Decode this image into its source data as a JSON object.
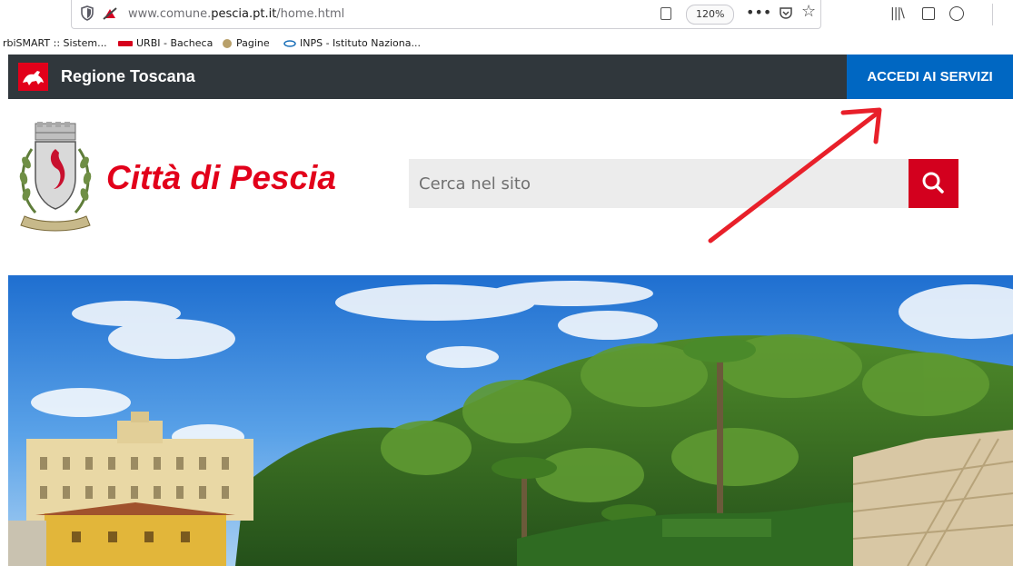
{
  "browser": {
    "url_prefix": "www.comune.",
    "url_domain": "pescia.pt.it",
    "url_path": "/home.html",
    "zoom": "120%",
    "bookmarks": [
      {
        "label": "rbiSMART :: Sistem..."
      },
      {
        "label": "URBI - Bacheca"
      },
      {
        "label": "Pagine"
      },
      {
        "label": "INPS - Istituto Naziona..."
      }
    ]
  },
  "region_bar": {
    "name": "Regione Toscana",
    "login_label": "ACCEDI AI SERVIZI"
  },
  "header": {
    "city_name": "Città di Pescia",
    "search_placeholder": "Cerca nel sito"
  },
  "colors": {
    "region_bar_bg": "#30373c",
    "accent_blue": "#0067c2",
    "brand_red": "#e2001a",
    "annotation_arrow": "#e8202a"
  }
}
